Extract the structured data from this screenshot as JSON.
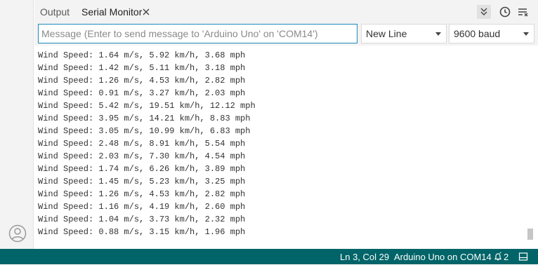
{
  "tabs": {
    "output_label": "Output",
    "serial_label": "Serial Monitor"
  },
  "input": {
    "placeholder": "Message (Enter to send message to 'Arduino Uno' on 'COM14')",
    "value": ""
  },
  "line_ending": {
    "selected": "New Line"
  },
  "baud_rate": {
    "selected": "9600 baud"
  },
  "serial_lines": [
    "Wind Speed: 1.64 m/s, 5.92 km/h, 3.68 mph",
    "Wind Speed: 1.42 m/s, 5.11 km/h, 3.18 mph",
    "Wind Speed: 1.26 m/s, 4.53 km/h, 2.82 mph",
    "Wind Speed: 0.91 m/s, 3.27 km/h, 2.03 mph",
    "Wind Speed: 5.42 m/s, 19.51 km/h, 12.12 mph",
    "Wind Speed: 3.95 m/s, 14.21 km/h, 8.83 mph",
    "Wind Speed: 3.05 m/s, 10.99 km/h, 6.83 mph",
    "Wind Speed: 2.48 m/s, 8.91 km/h, 5.54 mph",
    "Wind Speed: 2.03 m/s, 7.30 km/h, 4.54 mph",
    "Wind Speed: 1.74 m/s, 6.26 km/h, 3.89 mph",
    "Wind Speed: 1.45 m/s, 5.23 km/h, 3.25 mph",
    "Wind Speed: 1.26 m/s, 4.53 km/h, 2.82 mph",
    "Wind Speed: 1.16 m/s, 4.19 km/h, 2.60 mph",
    "Wind Speed: 1.04 m/s, 3.73 km/h, 2.32 mph",
    "Wind Speed: 0.88 m/s, 3.15 km/h, 1.96 mph"
  ],
  "statusbar": {
    "position": "Ln 3, Col 29",
    "board": "Arduino Uno on COM14",
    "notification_count": "2"
  },
  "icons": {
    "tab_close": "close-icon",
    "autoscroll": "double-chevron-down-icon",
    "timestamp": "clock-icon",
    "clear": "clear-output-icon",
    "account": "account-icon",
    "notifications": "bell-icon",
    "toggle_panel": "panel-icon"
  },
  "colors": {
    "statusbar_bg": "#006468",
    "input_border": "#1f8bbb",
    "chrome_bg": "#f3f3f3"
  }
}
